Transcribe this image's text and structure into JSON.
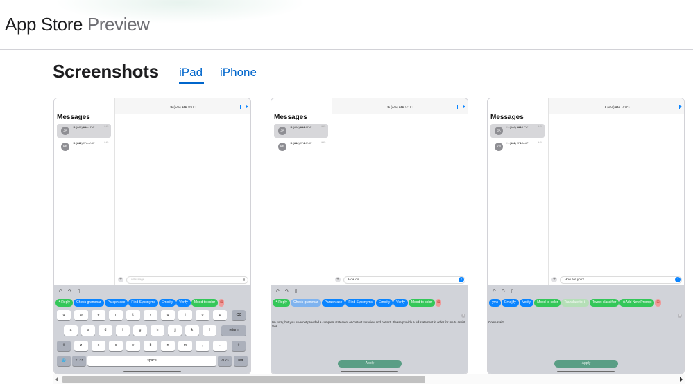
{
  "header": {
    "brand_main": "App Store",
    "brand_sub": "Preview"
  },
  "screenshots_section": {
    "title": "Screenshots",
    "tabs": [
      {
        "label": "iPad",
        "selected": true
      },
      {
        "label": "iPhone",
        "selected": false
      }
    ]
  },
  "shots": [
    {
      "status_left": "",
      "status_right": "دوشنبه ۴ تیر ۱۲:۳۴",
      "sidebar_title": "Messages",
      "conversations": [
        {
          "initials": "JA",
          "name": "+1 (۸۸۸) ۵۵۵-۱۲۱۲",
          "time": "۹:۴۱",
          "preview": "",
          "selected": true
        },
        {
          "initials": "KB",
          "name": "+1 (۵۵۵) ۷۲۵-۸۱۸۳",
          "time": "۹:۴۱",
          "preview": "",
          "selected": false
        }
      ],
      "contact": "+1 (۸۸۸) ۵۵۵-۱۲۱۲ ›",
      "compose_placeholder": "iMessage",
      "compose_text": "",
      "tools": "↶ ↷ ▯",
      "chips": [
        {
          "label": "↰Reply",
          "color": "green"
        },
        {
          "label": "Check grammar",
          "color": "blue"
        },
        {
          "label": "Paraphrase",
          "color": "blue"
        },
        {
          "label": "Find Synonyms",
          "color": "blue"
        },
        {
          "label": "Emojify",
          "color": "blue"
        },
        {
          "label": "Verify",
          "color": "blue"
        },
        {
          "label": "Mood to color",
          "color": "green"
        },
        {
          "label": "⊞",
          "color": "red"
        }
      ],
      "keyboard": {
        "row1": [
          "q",
          "w",
          "e",
          "r",
          "t",
          "y",
          "u",
          "i",
          "o",
          "p",
          "⌫"
        ],
        "row2": [
          "a",
          "s",
          "d",
          "f",
          "g",
          "h",
          "j",
          "k",
          "l",
          "return"
        ],
        "row3": [
          "⇧",
          "z",
          "x",
          "c",
          "v",
          "b",
          "n",
          "m",
          ",",
          ".",
          "⇧"
        ],
        "row4": [
          "🌐",
          "?123",
          "space",
          "?123",
          "⌨"
        ]
      }
    },
    {
      "status_left": "",
      "status_right": "دوشنبه ۴ تیر ۱۲:۳۴",
      "sidebar_title": "Messages",
      "conversations": [
        {
          "initials": "JA",
          "name": "+1 (۸۸۸) ۵۵۵-۱۲۱۲",
          "time": "۹:۴۱",
          "preview": "",
          "selected": true
        },
        {
          "initials": "KB",
          "name": "+1 (۵۵۵) ۷۲۵-۸۱۸۳",
          "time": "۹:۴۱",
          "preview": "",
          "selected": false
        }
      ],
      "contact": "+1 (۸۸۸) ۵۵۵-۱۲۱۲ ›",
      "compose_placeholder": "",
      "compose_text": "How do",
      "tools": "↶ ↷ ▯",
      "chips": [
        {
          "label": "↰Reply",
          "color": "green"
        },
        {
          "label": "Check grammar",
          "color": "lblue"
        },
        {
          "label": "Paraphrase",
          "color": "blue"
        },
        {
          "label": "Find Synonyms",
          "color": "blue"
        },
        {
          "label": "Emojify",
          "color": "blue"
        },
        {
          "label": "Verify",
          "color": "blue"
        },
        {
          "label": "Mood to color",
          "color": "green"
        },
        {
          "label": "⊞",
          "color": "red"
        }
      ],
      "output": "I'm sorry, but you have not provided a complete statement or context to review and correct. Please provide a full statement in order for me to assist you.",
      "apply_label": "Apply"
    },
    {
      "status_left": "",
      "status_right": "دوشنبه ۴ تیر ۱۲:۳۴",
      "sidebar_title": "Messages",
      "conversations": [
        {
          "initials": "JA",
          "name": "+1 (۸۸۸) ۵۵۵-۱۲۱۲",
          "time": "۹:۴۱",
          "preview": "",
          "selected": true
        },
        {
          "initials": "KB",
          "name": "+1 (۵۵۵) ۷۲۵-۸۱۸۳",
          "time": "۹:۴۱",
          "preview": "",
          "selected": false
        }
      ],
      "contact": "+1 (۸۸۸) ۵۵۵-۱۲۱۲ ›",
      "compose_placeholder": "",
      "compose_text": "How are you?",
      "tools": "↶ ↷ ▯",
      "chips": [
        {
          "label": "yms",
          "color": "blue"
        },
        {
          "label": "Emojify",
          "color": "blue"
        },
        {
          "label": "Verify",
          "color": "blue"
        },
        {
          "label": "Mood to color",
          "color": "green"
        },
        {
          "label": "Translate to ⬇",
          "color": "lgreen"
        },
        {
          "label": "Tweet classifier",
          "color": "green"
        },
        {
          "label": "⊕Add New Prompt",
          "color": "green"
        },
        {
          "label": "⊞",
          "color": "red"
        }
      ],
      "output": "Come stai?",
      "apply_label": "Apply"
    }
  ]
}
